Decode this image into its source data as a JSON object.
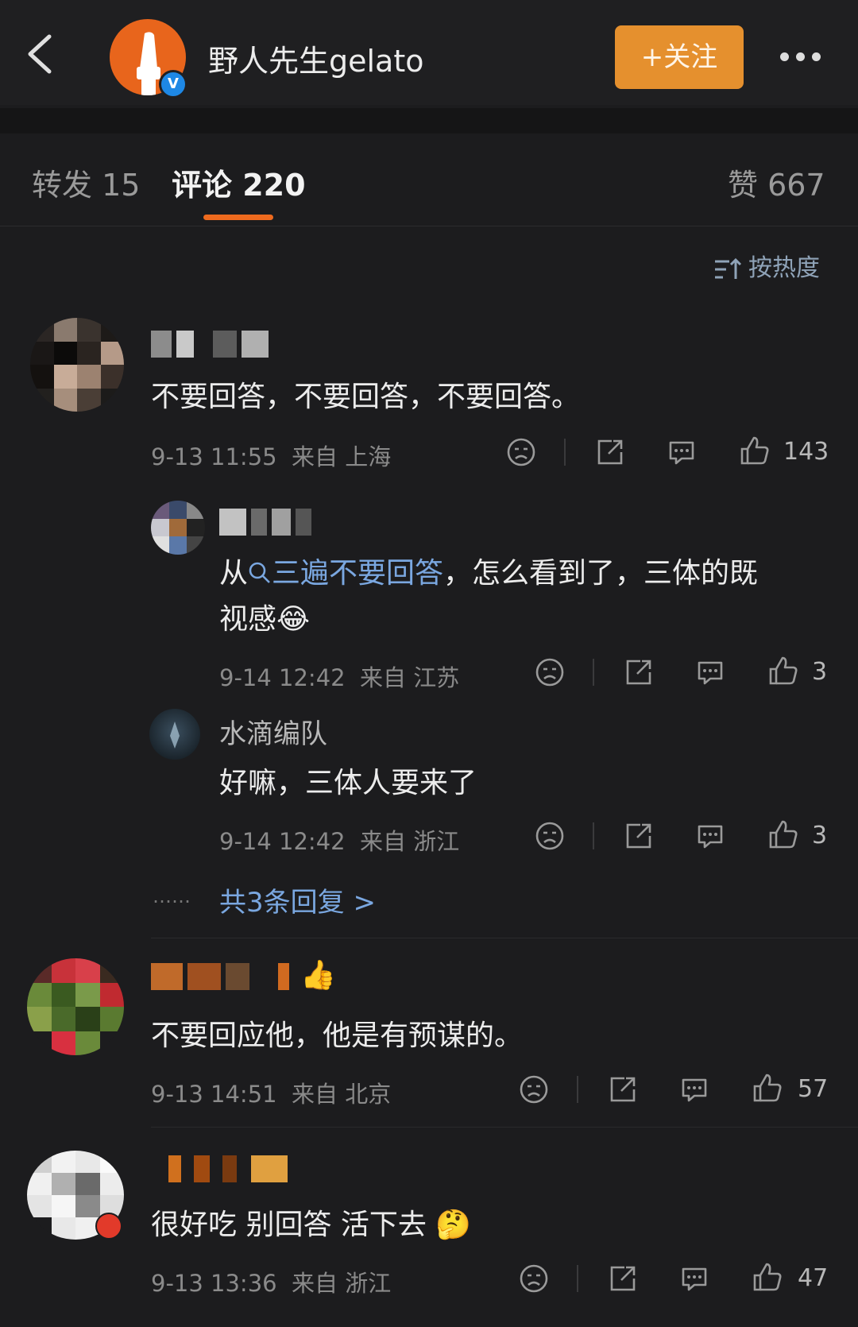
{
  "header": {
    "title": "野人先生gelato",
    "follow_label": "+关注",
    "verified_badge": "V"
  },
  "tabs": [
    {
      "label": "转发 15"
    },
    {
      "label": "评论 220"
    },
    {
      "label": "赞 667"
    }
  ],
  "sort": {
    "label": "按热度"
  },
  "comments": [
    {
      "text": "不要回答，不要回答，不要回答。",
      "time": "9-13 11:55",
      "location": "来自 上海",
      "likes": "143",
      "replies": [
        {
          "text_prefix": "从",
          "hashtag": "三遍不要回答",
          "text_suffix": "，怎么看到了，三体的既",
          "text_line2": "视感",
          "emoji": "😂",
          "time": "9-14 12:42",
          "location": "来自 江苏",
          "likes": "3"
        },
        {
          "name": "水滴编队",
          "text": "好嘛，三体人要来了",
          "time": "9-14 12:42",
          "location": "来自 浙江",
          "likes": "3"
        }
      ],
      "more_replies": "共3条回复 >",
      "dots": "……"
    },
    {
      "text": "不要回应他，他是有预谋的。",
      "time": "9-13 14:51",
      "location": "来自 北京",
      "likes": "57"
    },
    {
      "text": "很好吃 别回答 活下去",
      "emoji": "🤔",
      "time": "9-13 13:36",
      "location": "来自 浙江",
      "likes": "47"
    }
  ],
  "icons": {
    "back": "chevron-left-icon",
    "more": "more-dots-icon",
    "sort": "sort-icon",
    "dislike": "sad-face-icon",
    "share": "share-icon",
    "comment": "comment-bubble-icon",
    "like": "thumbs-up-icon"
  },
  "colors": {
    "background": "#1c1c1e",
    "accent": "#ee6a1e",
    "follow_button": "#e5902e",
    "link": "#7aa7e0"
  }
}
